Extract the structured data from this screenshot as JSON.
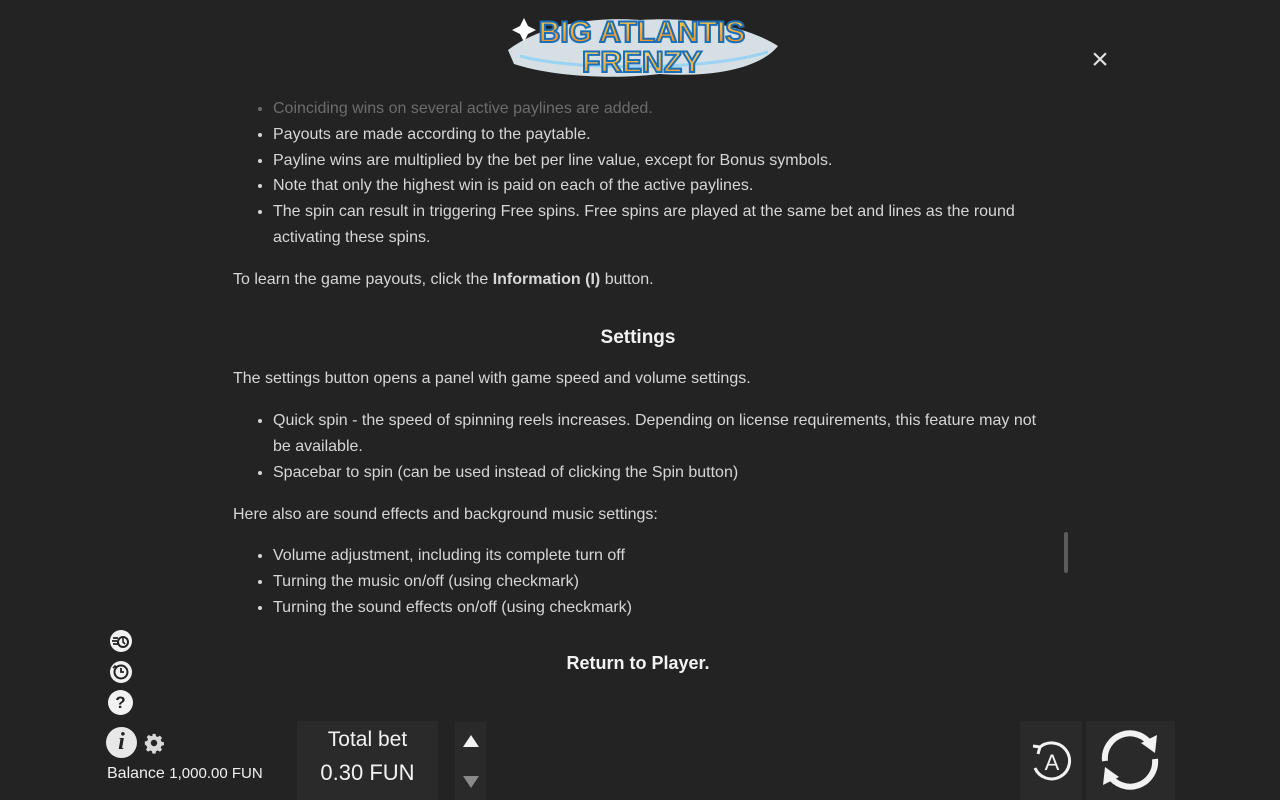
{
  "logo": {
    "line1": "BIG ATLANTIS",
    "line2": "FRENZY"
  },
  "close": {
    "glyph": "×"
  },
  "rules": {
    "faded_item": "Coinciding wins on several active paylines are added.",
    "items": [
      "Payouts are made according to the paytable.",
      "Payline wins are multiplied by the bet per line value, except for Bonus symbols.",
      "Note that only the highest win is paid on each of the active paylines.",
      "The spin can result in triggering Free spins. Free spins are played at the same bet and lines as the round activating these spins."
    ],
    "payouts_prefix": "To learn the game payouts, click the ",
    "payouts_bold": "Information (I)",
    "payouts_suffix": " button."
  },
  "settings": {
    "heading": "Settings",
    "intro": "The settings button opens a panel with game speed and volume settings.",
    "items": [
      "Quick spin - the speed of spinning reels increases. Depending on license requirements, this feature may not be available.",
      "Spacebar to spin (can be used instead of clicking the Spin button)"
    ],
    "sound_intro": "Here also are sound effects and background music settings:",
    "sound_items": [
      "Volume adjustment, including its complete turn off",
      "Turning the music on/off (using checkmark)",
      "Turning the sound effects on/off (using checkmark)"
    ]
  },
  "return_link": "Return to Player.",
  "side": {
    "help_glyph": "?",
    "info_glyph": "i"
  },
  "balance": {
    "label": "Balance",
    "value": "1,000.00 FUN"
  },
  "bet": {
    "label": "Total bet",
    "value": "0.30 FUN"
  },
  "auto": {
    "glyph": "A"
  },
  "colors": {
    "background": "#232323",
    "panel": "#2a2a2a",
    "text": "#d6d6d6",
    "logo_blue": "#1a9be0",
    "logo_orange": "#f2811d"
  }
}
